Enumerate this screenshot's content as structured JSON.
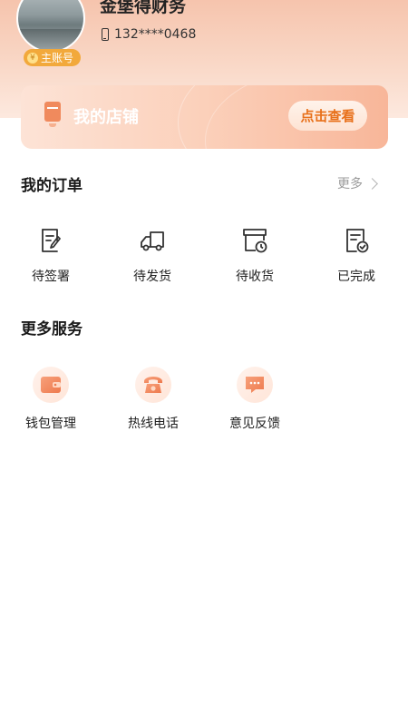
{
  "profile": {
    "name": "金堡得财务",
    "phone": "132****0468",
    "badge": "主账号"
  },
  "shop": {
    "title": "我的店铺",
    "button": "点击查看"
  },
  "orders": {
    "title": "我的订单",
    "more": "更多",
    "items": [
      {
        "label": "待签署",
        "icon": "sign-doc-icon"
      },
      {
        "label": "待发货",
        "icon": "truck-icon"
      },
      {
        "label": "待收货",
        "icon": "receive-box-icon"
      },
      {
        "label": "已完成",
        "icon": "completed-doc-icon"
      }
    ]
  },
  "services": {
    "title": "更多服务",
    "items": [
      {
        "label": "钱包管理",
        "icon": "wallet-icon"
      },
      {
        "label": "热线电话",
        "icon": "telephone-icon"
      },
      {
        "label": "意见反馈",
        "icon": "feedback-icon"
      }
    ]
  },
  "colors": {
    "accent": "#f08a5d",
    "button_text": "#e8711b",
    "badge": "#f2a93b"
  }
}
